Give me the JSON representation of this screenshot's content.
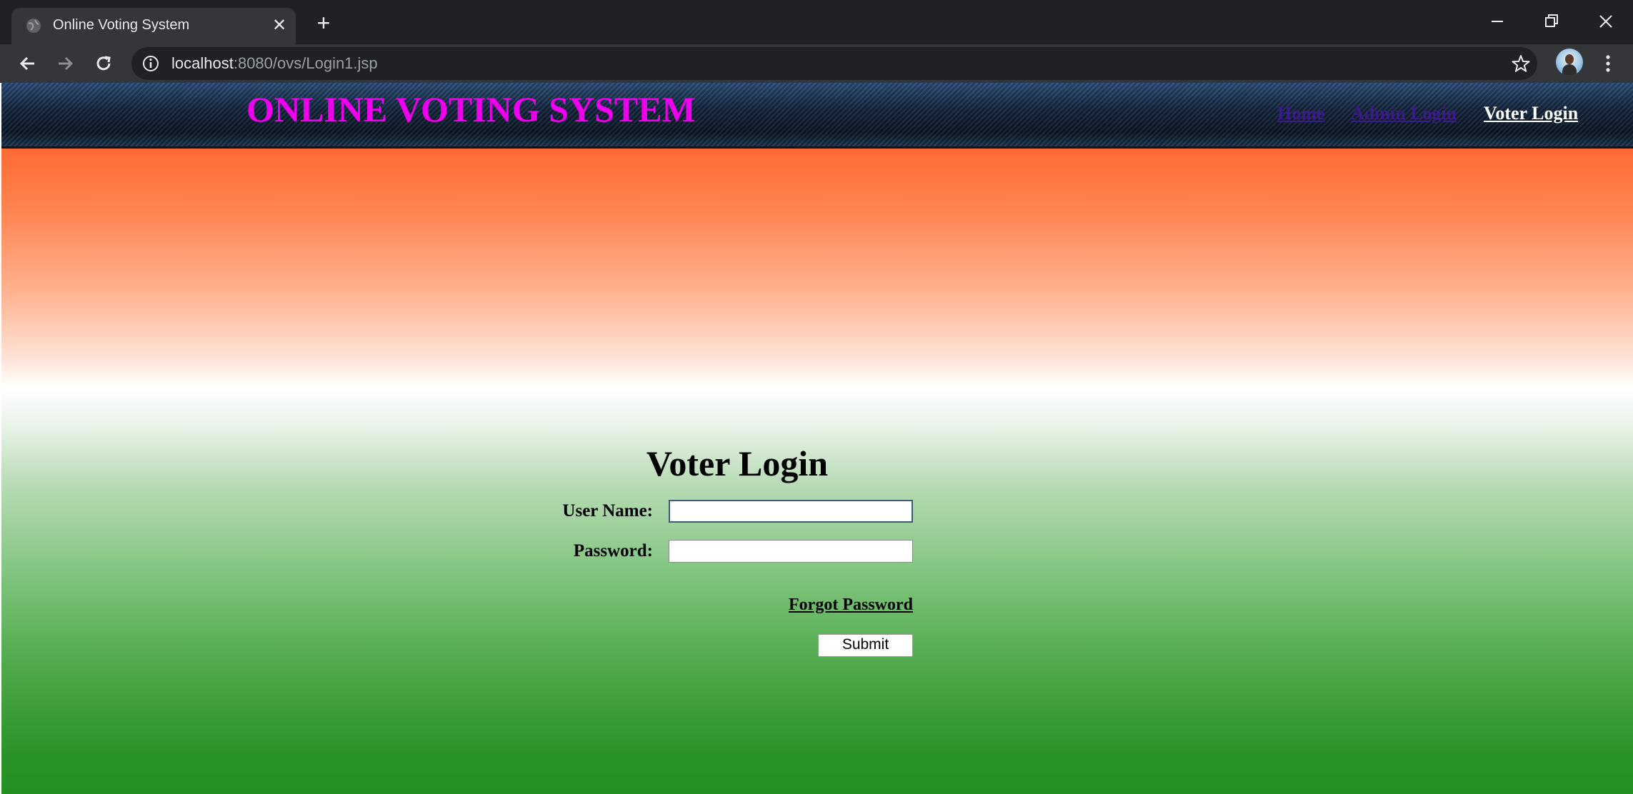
{
  "browser": {
    "tab_title": "Online Voting System",
    "tab_close": "✕",
    "new_tab": "+",
    "url_host": "localhost",
    "url_rest": ":8080/ovs/Login1.jsp"
  },
  "site": {
    "title": "ONLINE VOTING SYSTEM",
    "nav": {
      "home": "Home",
      "admin_login": "Admin Login",
      "voter_login": "Voter Login"
    }
  },
  "login": {
    "heading": "Voter Login",
    "username_label": "User Name:",
    "username_value": "",
    "password_label": "Password:",
    "password_value": "",
    "forgot_password": "Forgot Password",
    "submit": "Submit"
  },
  "colors": {
    "title": "#ee00ee",
    "saffron": "#ff6a33",
    "green": "#249022",
    "visited_link": "#3c1a8c"
  }
}
